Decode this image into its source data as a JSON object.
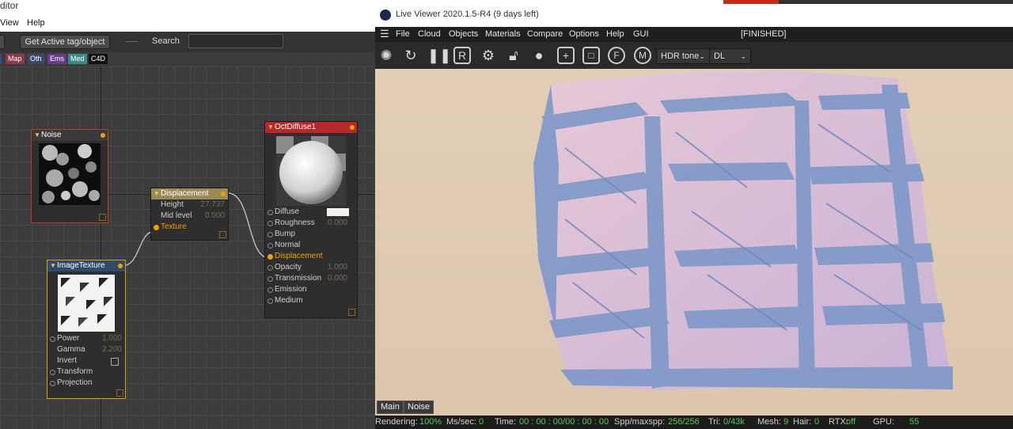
{
  "editor": {
    "title_fragment": "ditor",
    "menu": [
      "View",
      "Help"
    ],
    "toolbar": {
      "get_active_label": "Get Active tag/object",
      "search_label": "Search",
      "search_value": ""
    },
    "filters": [
      {
        "label": "Map",
        "color": "#8a3a4a"
      },
      {
        "label": "Oth",
        "color": "#3a4a6a"
      },
      {
        "label": "Ems",
        "color": "#6a3a8a"
      },
      {
        "label": "Med",
        "color": "#3a8a8a"
      },
      {
        "label": "C4D",
        "color": "#111111"
      }
    ],
    "nodes": {
      "noise": {
        "title": "Noise",
        "header_color": "#3a3a3a"
      },
      "displacement": {
        "title": "Displacement",
        "header_color": "#9a8a5a",
        "ports": [
          {
            "label": "Height",
            "value": "27.737"
          },
          {
            "label": "Mid level",
            "value": "0.000"
          },
          {
            "label": "Texture",
            "value": ""
          }
        ]
      },
      "image_texture": {
        "title": "ImageTexture",
        "header_color": "#2f4a6a",
        "ports": [
          {
            "label": "Power",
            "value": "1.000"
          },
          {
            "label": "Gamma",
            "value": "2.200"
          },
          {
            "label": "Invert",
            "value": ""
          },
          {
            "label": "Transform",
            "value": ""
          },
          {
            "label": "Projection",
            "value": ""
          }
        ]
      },
      "oct_diffuse": {
        "title": "OctDiffuse1",
        "header_color": "#b8282a",
        "ports": [
          {
            "label": "Diffuse",
            "value": ""
          },
          {
            "label": "Roughness",
            "value": "0.000"
          },
          {
            "label": "Bump",
            "value": ""
          },
          {
            "label": "Normal",
            "value": ""
          },
          {
            "label": "Displacement",
            "value": ""
          },
          {
            "label": "Opacity",
            "value": "1.000"
          },
          {
            "label": "Transmission",
            "value": "0.000"
          },
          {
            "label": "Emission",
            "value": ""
          },
          {
            "label": "Medium",
            "value": ""
          }
        ]
      }
    }
  },
  "viewer": {
    "title": "Live Viewer 2020.1.5-R4 (9 days left)",
    "menu": [
      "File",
      "Cloud",
      "Objects",
      "Materials",
      "Compare",
      "Options",
      "Help",
      "GUI"
    ],
    "status_tag": "[FINISHED]",
    "toolbar_icons": [
      "aperture-icon",
      "refresh-icon",
      "pause-icon",
      "r-icon",
      "gear-icon",
      "lock-icon",
      "sphere-icon",
      "add-region-icon",
      "region-icon",
      "f-pin-icon",
      "m-pin-icon"
    ],
    "tone_dropdown": "HDR tone",
    "kernel_dropdown": "DL",
    "render_tabs": [
      "Main",
      "Noise"
    ],
    "status": {
      "rendering_label": "Rendering:",
      "rendering_value": "100%",
      "ms_label": "Ms/sec:",
      "ms_value": "0",
      "time_label": "Time:",
      "time_value": "00 : 00 : 00/00 : 00 : 00",
      "spp_label": "Spp/maxspp:",
      "spp_value": "256/256",
      "tri_label": "Tri:",
      "tri_value": "0/43k",
      "mesh_label": "Mesh:",
      "mesh_value": "9",
      "hair_label": "Hair:",
      "hair_value": "0",
      "rtx_label": "RTX:",
      "rtx_value": "off",
      "gpu_label": "GPU:",
      "gpu_value": "55"
    }
  }
}
